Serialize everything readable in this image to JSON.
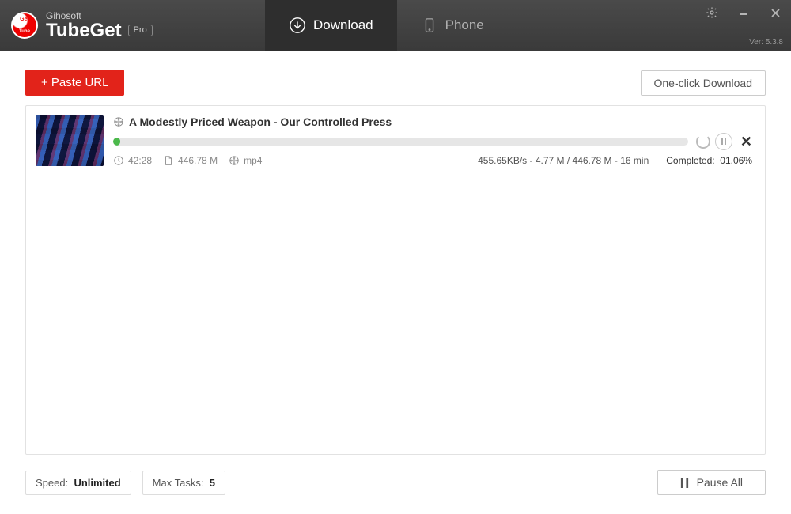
{
  "brand": {
    "company": "Gihosoft",
    "product": "TubeGet",
    "badge": "Pro"
  },
  "version": "Ver: 5.3.8",
  "tabs": {
    "download": "Download",
    "phone": "Phone"
  },
  "toolbar": {
    "paste_url": "+ Paste URL",
    "one_click": "One-click Download"
  },
  "item": {
    "title": "A Modestly Priced Weapon - Our Controlled Press",
    "duration": "42:28",
    "size": "446.78 M",
    "format": "mp4",
    "speed_eta": "455.65KB/s - 4.77 M / 446.78 M - 16 min",
    "completed_label": "Completed:",
    "completed_value": "01.06%",
    "progress_percent": 1.06
  },
  "footer": {
    "speed_label": "Speed:",
    "speed_value": "Unlimited",
    "maxtasks_label": "Max Tasks:",
    "maxtasks_value": "5",
    "pause_all": "Pause All"
  }
}
